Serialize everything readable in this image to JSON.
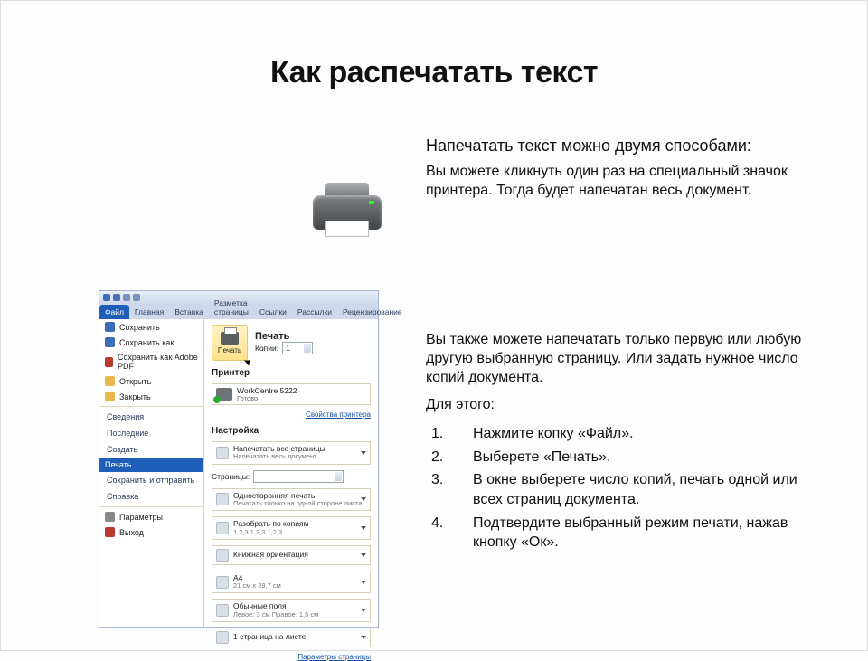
{
  "title": "Как распечатать текст",
  "intro": {
    "lead": "Напечатать текст можно двумя способами:",
    "body": "Вы можете кликнуть один раз на специальный значок принтера. Тогда будет напечатан весь документ."
  },
  "detail": {
    "p1": "Вы также можете напечатать только первую или любую другую выбранную страницу. Или задать нужное число копий документа.",
    "p2": "Для этого:",
    "steps": [
      "Нажмите копку «Файл».",
      "Выберете «Печать».",
      "В окне выберете число копий, печать одной или всех страниц документа.",
      "Подтвердите выбранный режим печати, нажав кнопку «Ок»."
    ]
  },
  "word": {
    "tabs": [
      "Файл",
      "Главная",
      "Вставка",
      "Разметка страницы",
      "Ссылки",
      "Рассылки",
      "Рецензирование"
    ],
    "active_tab": 0,
    "menu": {
      "save": "Сохранить",
      "saveas": "Сохранить как",
      "savepdf": "Сохранить как Adobe PDF",
      "open": "Открыть",
      "close": "Закрыть",
      "info": "Сведения",
      "recent": "Последние",
      "new": "Создать",
      "print": "Печать",
      "share": "Сохранить и отправить",
      "help": "Справка",
      "options": "Параметры",
      "exit": "Выход"
    },
    "print": {
      "heading": "Печать",
      "button": "Печать",
      "copies_label": "Копии:",
      "copies_value": "1",
      "printer_label": "Принтер",
      "printer_name": "WorkCentre 5222",
      "printer_status": "Готово",
      "printer_props": "Свойства принтера",
      "settings_label": "Настройка",
      "pages_label": "Страницы:",
      "opts": [
        {
          "t1": "Напечатать все страницы",
          "t2": "Напечатать весь документ"
        },
        {
          "t1": "Односторонняя печать",
          "t2": "Печатать только на одной стороне листа"
        },
        {
          "t1": "Разобрать по копиям",
          "t2": "1,2,3   1,2,3   1,2,3"
        },
        {
          "t1": "Книжная ориентация",
          "t2": ""
        },
        {
          "t1": "A4",
          "t2": "21 см x 29,7 см"
        },
        {
          "t1": "Обычные поля",
          "t2": "Левое: 3 см   Правое: 1,5 см"
        },
        {
          "t1": "1 страница на листе",
          "t2": ""
        }
      ],
      "page_setup": "Параметры страницы"
    }
  }
}
